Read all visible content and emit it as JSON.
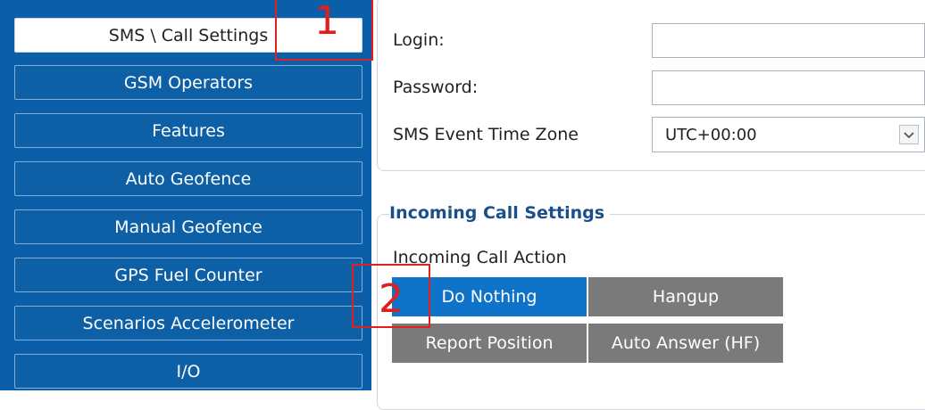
{
  "sidebar": {
    "items": [
      {
        "label": "SMS \\ Call Settings",
        "active": true
      },
      {
        "label": "GSM Operators"
      },
      {
        "label": "Features"
      },
      {
        "label": "Auto Geofence"
      },
      {
        "label": "Manual Geofence"
      },
      {
        "label": "GPS Fuel Counter"
      },
      {
        "label": "Scenarios Accelerometer"
      },
      {
        "label": "I/O"
      }
    ]
  },
  "sms_settings": {
    "login_label": "Login:",
    "login_value": "",
    "password_label": "Password:",
    "password_value": "",
    "timezone_label": "SMS Event Time Zone",
    "timezone_value": "UTC+00:00"
  },
  "incoming_call": {
    "group_title": "Incoming Call Settings",
    "action_label": "Incoming Call Action",
    "options": [
      {
        "label": "Do Nothing",
        "selected": true
      },
      {
        "label": "Hangup"
      },
      {
        "label": "Report Position"
      },
      {
        "label": "Auto Answer (HF)"
      }
    ]
  },
  "annotations": {
    "marker1": "1",
    "marker2": "2"
  },
  "colors": {
    "sidebar_bg": "#0b5fa8",
    "selected_option": "#0e73c9",
    "option_gray": "#7a7a7a",
    "annotation_red": "#e02020",
    "group_title": "#1a4f8a"
  }
}
